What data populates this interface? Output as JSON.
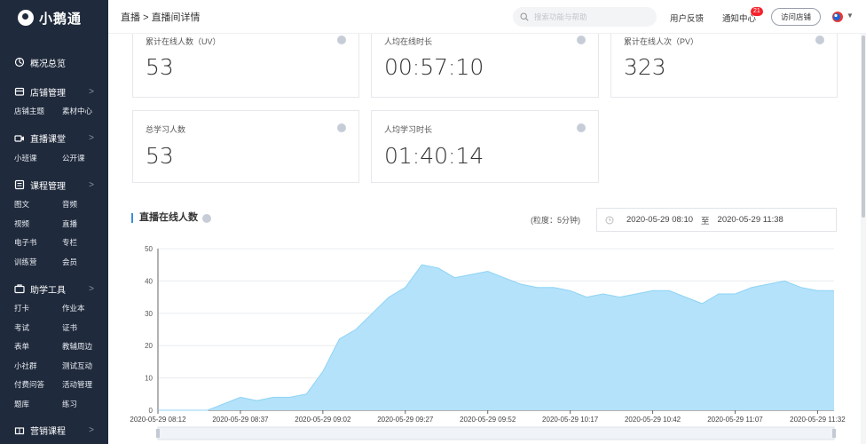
{
  "app": {
    "name": "小鹅通"
  },
  "sidebar": {
    "overview": "概况总览",
    "sections": [
      {
        "label": "店铺管理",
        "icon": "shop-icon",
        "items": [
          "店铺主题",
          "素材中心"
        ]
      },
      {
        "label": "直播课堂",
        "icon": "video-icon",
        "items": [
          "小班课",
          "公开课"
        ]
      },
      {
        "label": "课程管理",
        "icon": "list-icon",
        "items": [
          "图文",
          "音频",
          "视频",
          "直播",
          "电子书",
          "专栏",
          "训练营",
          "会员"
        ]
      },
      {
        "label": "助学工具",
        "icon": "toolbox-icon",
        "items": [
          "打卡",
          "作业本",
          "考试",
          "证书",
          "表单",
          "教辅周边",
          "小社群",
          "测试互动",
          "付费问答",
          "活动管理",
          "题库",
          "练习"
        ]
      },
      {
        "label": "营销课程",
        "icon": "gift-icon",
        "items": []
      }
    ]
  },
  "header": {
    "breadcrumb_root": "直播",
    "breadcrumb_sep": ">",
    "breadcrumb_current": "直播间详情",
    "search_placeholder": "搜索功能与帮助",
    "feedback": "用户反馈",
    "notifications": "通知中心",
    "notification_count": "21",
    "visit_store": "访问店铺"
  },
  "stats": [
    {
      "label": "累计在线人数（UV）",
      "value": "53"
    },
    {
      "label": "人均在线时长",
      "value": "00:57:10"
    },
    {
      "label": "累计在线人次（PV）",
      "value": "323"
    },
    {
      "label": "总学习人数",
      "value": "53"
    },
    {
      "label": "人均学习时长",
      "value": "01:40:14"
    }
  ],
  "chart_section": {
    "title": "直播在线人数",
    "granularity": "(粒度：5分钟)",
    "date_start": "2020-05-29 08:10",
    "date_to": "至",
    "date_end": "2020-05-29 11:38"
  },
  "chart_data": {
    "type": "area",
    "title": "直播在线人数",
    "ylim": [
      0,
      50
    ],
    "yticks": [
      0,
      10,
      20,
      30,
      40,
      50
    ],
    "xtick_labels": [
      "2020-05-29 08:12",
      "2020-05-29 08:37",
      "2020-05-29 09:02",
      "2020-05-29 09:27",
      "2020-05-29 09:52",
      "2020-05-29 10:17",
      "2020-05-29 10:42",
      "2020-05-29 11:07",
      "2020-05-29 11:32"
    ],
    "x": [
      "08:12",
      "08:17",
      "08:22",
      "08:27",
      "08:32",
      "08:37",
      "08:42",
      "08:47",
      "08:52",
      "08:57",
      "09:02",
      "09:07",
      "09:12",
      "09:17",
      "09:22",
      "09:27",
      "09:32",
      "09:37",
      "09:42",
      "09:47",
      "09:52",
      "09:57",
      "10:02",
      "10:07",
      "10:12",
      "10:17",
      "10:22",
      "10:27",
      "10:32",
      "10:37",
      "10:42",
      "10:47",
      "10:52",
      "10:57",
      "11:02",
      "11:07",
      "11:12",
      "11:17",
      "11:22",
      "11:27",
      "11:32",
      "11:37"
    ],
    "values": [
      0,
      0,
      0,
      0,
      2,
      4,
      3,
      4,
      4,
      5,
      12,
      22,
      25,
      30,
      35,
      38,
      45,
      44,
      41,
      42,
      43,
      41,
      39,
      38,
      38,
      37,
      35,
      36,
      35,
      36,
      37,
      37,
      35,
      33,
      36,
      36,
      38,
      39,
      40,
      38,
      37,
      37
    ],
    "colors": {
      "fill": "#b3e2fa",
      "stroke": "#8fd3f5",
      "grid": "#e9ecef",
      "axis": "#666666"
    }
  }
}
